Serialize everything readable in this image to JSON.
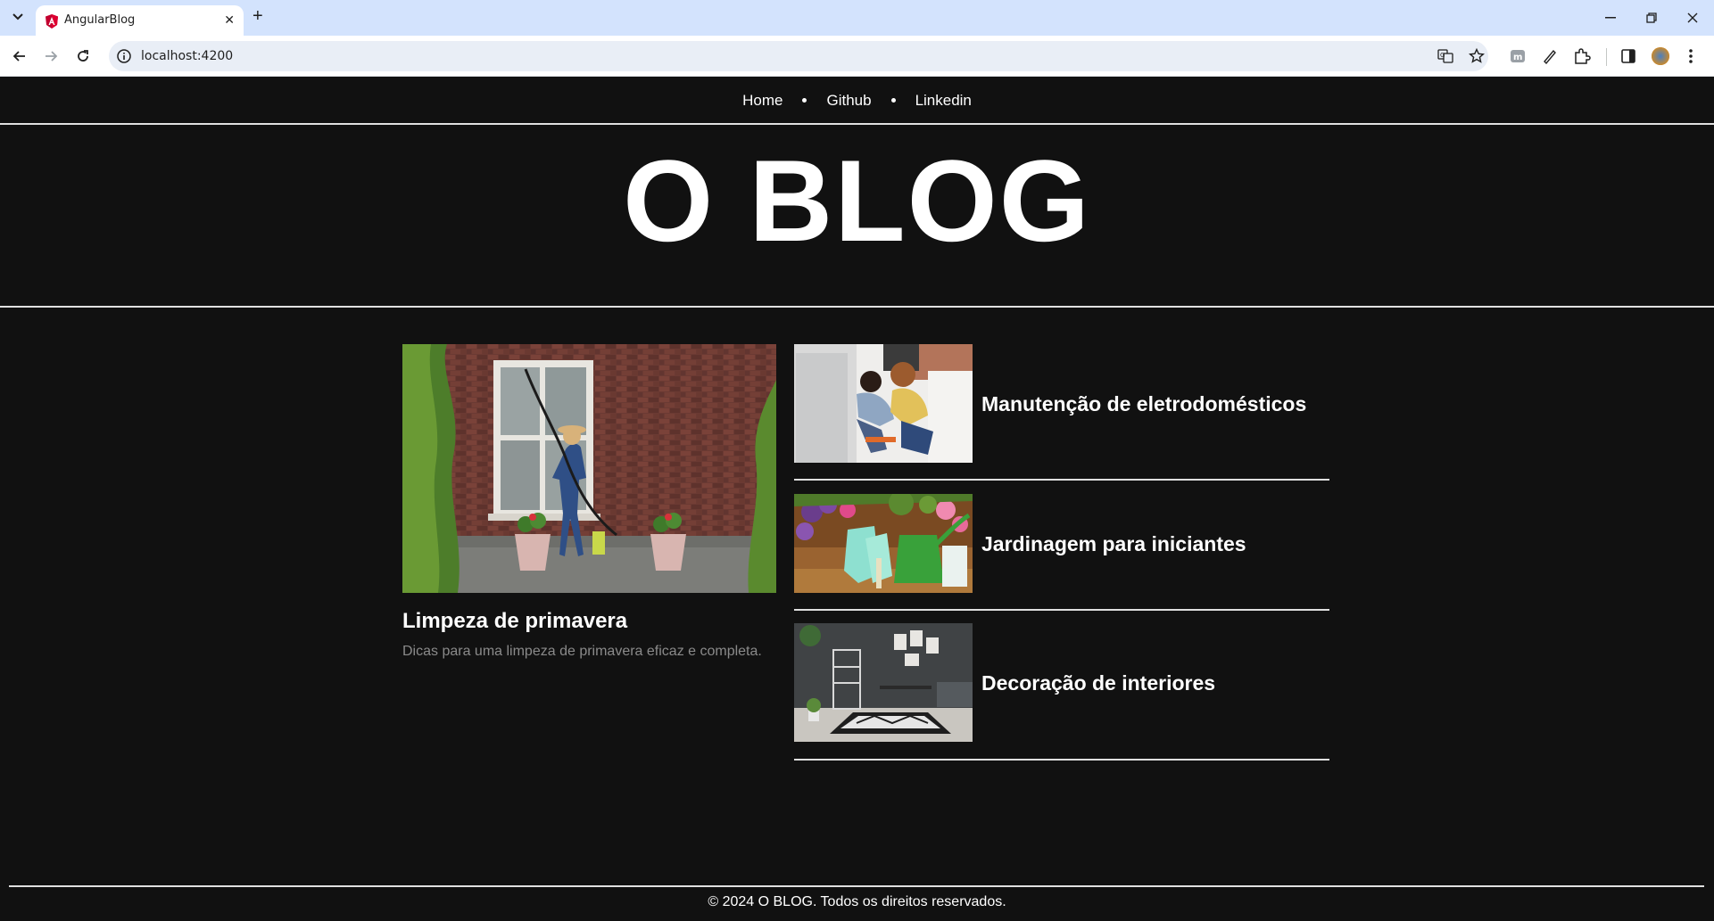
{
  "browser": {
    "tab_title": "AngularBlog",
    "url": "localhost:4200"
  },
  "nav": {
    "links": [
      "Home",
      "Github",
      "Linkedin"
    ]
  },
  "site": {
    "title": "O BLOG"
  },
  "featured": {
    "title": "Limpeza de primavera",
    "description": "Dicas para uma limpeza de primavera eficaz e completa."
  },
  "posts": [
    {
      "title": "Manutenção de eletrodomésticos"
    },
    {
      "title": "Jardinagem para iniciantes"
    },
    {
      "title": "Decoração de interiores"
    }
  ],
  "footer": {
    "text": "© 2024 O BLOG. Todos os direitos reservados."
  },
  "colors": {
    "page_bg": "#111111",
    "browser_tabbar": "#d3e3fd",
    "text": "#ffffff",
    "muted_text": "#8a8a8a"
  }
}
